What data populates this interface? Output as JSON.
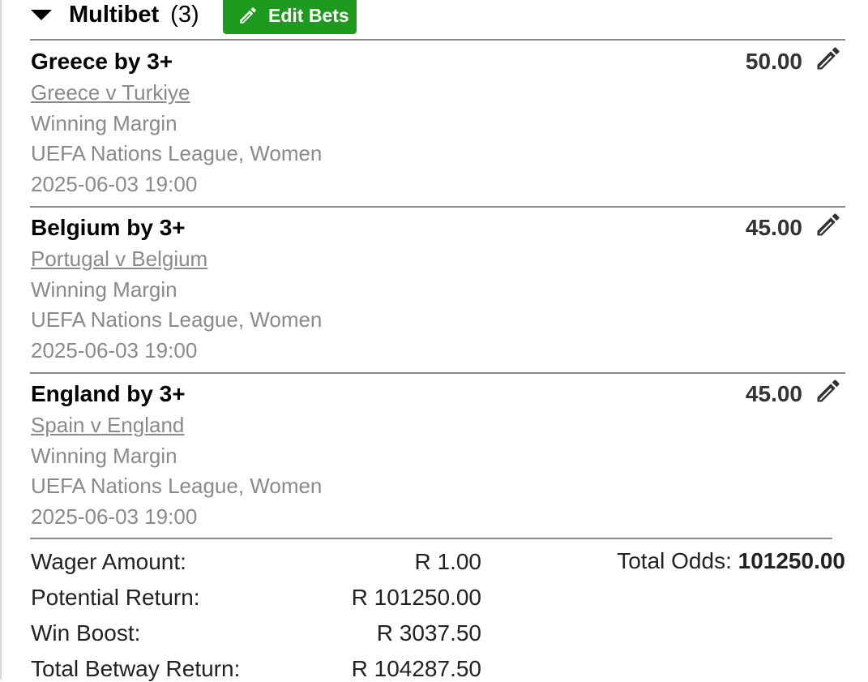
{
  "multibet": {
    "title": "Multibet",
    "count": "(3)",
    "edit_bets_label": "Edit Bets"
  },
  "bets": [
    {
      "selection": "Greece by 3+",
      "odds": "50.00",
      "event": "Greece v Turkiye",
      "market": "Winning Margin",
      "league": "UEFA Nations League, Women",
      "datetime": "2025-06-03 19:00"
    },
    {
      "selection": "Belgium by 3+",
      "odds": "45.00",
      "event": "Portugal v Belgium",
      "market": "Winning Margin",
      "league": "UEFA Nations League, Women",
      "datetime": "2025-06-03 19:00"
    },
    {
      "selection": "England by 3+",
      "odds": "45.00",
      "event": "Spain v England",
      "market": "Winning Margin",
      "league": "UEFA Nations League, Women",
      "datetime": "2025-06-03 19:00"
    }
  ],
  "summary": {
    "wager_label": "Wager Amount:",
    "wager_value": "R 1.00",
    "potential_label": "Potential Return:",
    "potential_value": "R 101250.00",
    "boost_label": "Win Boost:",
    "boost_value": "R 3037.50",
    "total_return_label": "Total Betway Return:",
    "total_return_value": "R 104287.50",
    "total_odds_label": "Total Odds:",
    "total_odds_value": "101250.00"
  },
  "icons": {
    "collapse": "caret-down-icon",
    "edit": "pencil-icon"
  },
  "colors": {
    "accent_green": "#1e9a1e",
    "muted_text": "#8a8a8a"
  }
}
